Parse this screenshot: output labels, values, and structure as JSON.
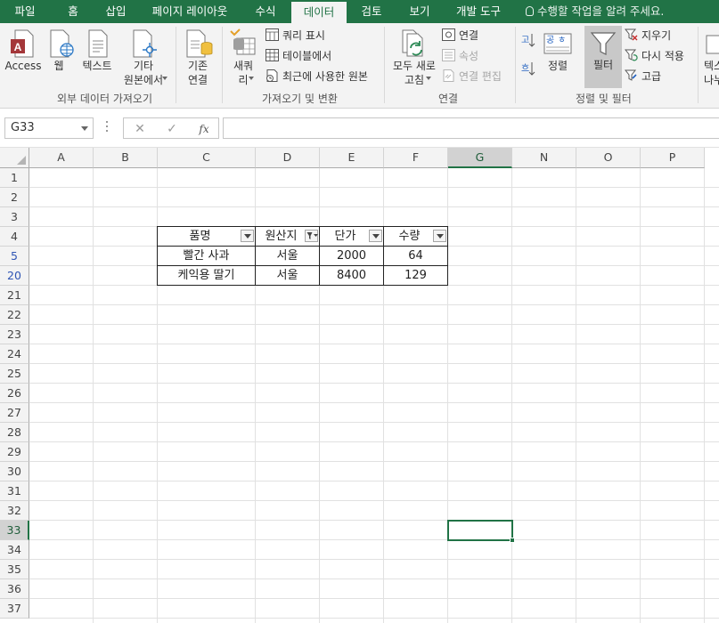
{
  "tabs": [
    {
      "label": "파일"
    },
    {
      "label": "홈"
    },
    {
      "label": "삽입"
    },
    {
      "label": "페이지 레이아웃"
    },
    {
      "label": "수식"
    },
    {
      "label": "데이터"
    },
    {
      "label": "검토"
    },
    {
      "label": "보기"
    },
    {
      "label": "개발 도구"
    }
  ],
  "active_tab": "데이터",
  "tell_me": "수행할 작업을 알려 주세요.",
  "ribbon": {
    "get_external": {
      "label": "외부 데이터 가져오기",
      "access": "Access",
      "web": "웹",
      "text": "텍스트",
      "other_1": "기타",
      "other_2": "원본에서",
      "existing_1": "기존",
      "existing_2": "연결"
    },
    "get_transform": {
      "label": "가져오기 및 변환",
      "new_query_1": "새쿼",
      "new_query_2": "리",
      "show_queries": "쿼리 표시",
      "from_table": "테이블에서",
      "recent_sources": "최근에 사용한 원본"
    },
    "connections": {
      "label": "연결",
      "refresh_1": "모두 새로",
      "refresh_2": "고침",
      "connections": "연결",
      "properties": "속성",
      "edit_links": "연결 편집"
    },
    "sort_filter": {
      "label": "정렬 및 필터",
      "sort": "정렬",
      "filter": "필터",
      "clear": "지우기",
      "reapply": "다시 적용",
      "advanced": "고급",
      "sort_az_icon": "공ㅎ"
    },
    "cut_text": "텍스\n나누"
  },
  "name_box": "G33",
  "formula_bar": {
    "cancel": "✕",
    "enter": "✓",
    "fx": "fx",
    "value": ""
  },
  "columns": [
    {
      "label": "A",
      "width": 72
    },
    {
      "label": "B",
      "width": 72
    },
    {
      "label": "C",
      "width": 110
    },
    {
      "label": "D",
      "width": 72
    },
    {
      "label": "E",
      "width": 72
    },
    {
      "label": "F",
      "width": 72
    },
    {
      "label": "G",
      "width": 72
    },
    {
      "label": "N",
      "width": 72
    },
    {
      "label": "O",
      "width": 72
    },
    {
      "label": "P",
      "width": 72
    }
  ],
  "selected_column": "G",
  "rows": [
    "1",
    "2",
    "3",
    "4",
    "5",
    "20",
    "21",
    "22",
    "23",
    "24",
    "25",
    "26",
    "27",
    "28",
    "29",
    "30",
    "31",
    "32",
    "33",
    "34",
    "35",
    "36",
    "37"
  ],
  "filtered_rows": [
    "5",
    "20"
  ],
  "selected_row": "33",
  "table": {
    "headers": [
      "품명",
      "원산지",
      "단가",
      "수량"
    ],
    "filtered_column_index": 1,
    "rows": [
      [
        "빨간 사과",
        "서울",
        "2000",
        "64"
      ],
      [
        "케익용 딸기",
        "서울",
        "8400",
        "129"
      ]
    ]
  },
  "colors": {
    "accent": "#217346",
    "filtered_row_number": "#2f55b4"
  }
}
